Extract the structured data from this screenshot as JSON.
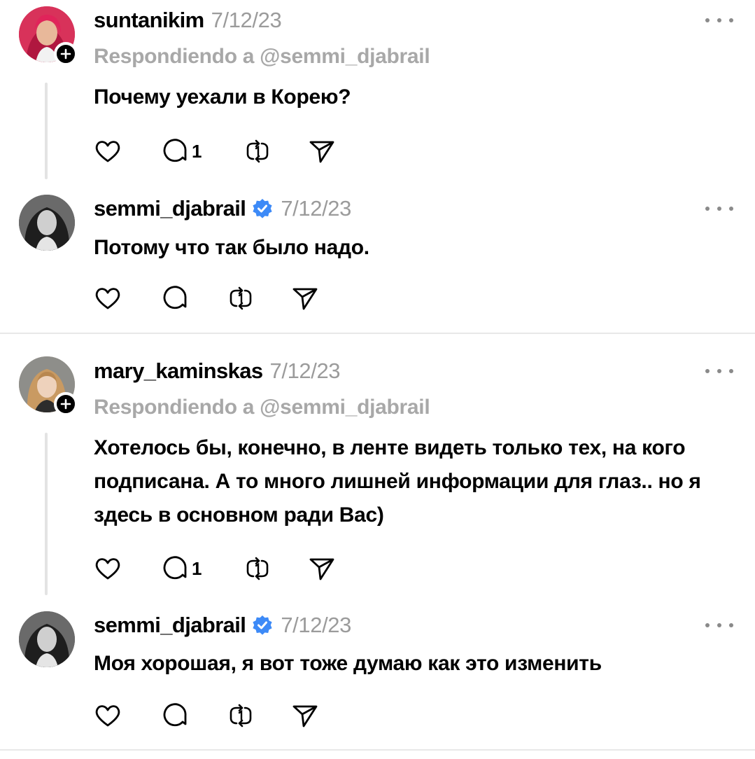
{
  "posts": [
    {
      "username": "suntanikim",
      "date": "7/12/23",
      "replying": "Respondiendo a @semmi_djabrail",
      "text": "Почему уехали в Корею?",
      "comments": "1",
      "verified": false
    },
    {
      "username": "semmi_djabrail",
      "date": "7/12/23",
      "text": "Потому что так было надо.",
      "comments": "",
      "verified": true
    },
    {
      "username": "mary_kaminskas",
      "date": "7/12/23",
      "replying": "Respondiendo a @semmi_djabrail",
      "text": "Хотелось бы, конечно, в ленте видеть только тех, на кого подписана. А то много лишней информации для глаз.. но я здесь в основном ради Вас)",
      "comments": "1",
      "verified": false
    },
    {
      "username": "semmi_djabrail",
      "date": "7/12/23",
      "text": "Моя хорошая, я вот тоже думаю как это изменить",
      "comments": "",
      "verified": true
    }
  ],
  "icons": {
    "like": "heart-icon",
    "comment": "comment-icon",
    "repost": "repost-icon",
    "share": "send-icon",
    "more": "more-icon",
    "verified": "verified-badge-icon",
    "follow": "plus-icon"
  },
  "colors": {
    "verified": "#3d8af7",
    "secondary_text": "#9b9b9b",
    "thread_line": "#e3e3e3"
  }
}
